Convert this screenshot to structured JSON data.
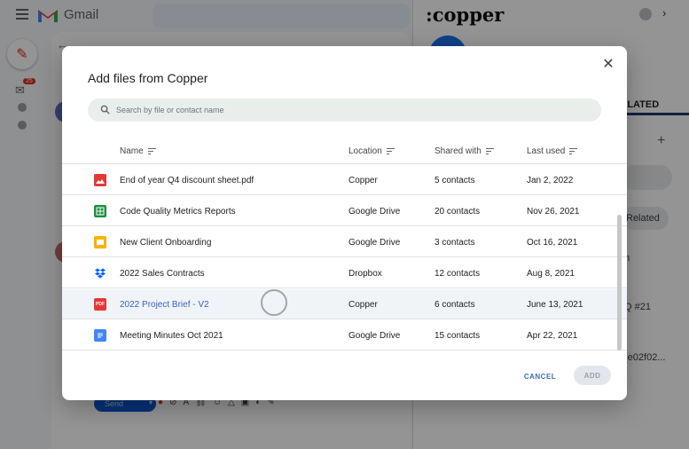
{
  "gmail": {
    "title": "Gmail",
    "badge_count": "25",
    "send_label": "Send"
  },
  "copper": {
    "logo": ":copper",
    "tab_label": "ELATED",
    "related_label": "Related",
    "fragment_1": "h",
    "fragment_2": "Q #21",
    "fragment_3": "(e02f02..."
  },
  "modal": {
    "title": "Add files from Copper",
    "search_placeholder": "Search by file or contact name",
    "columns": {
      "name": "Name",
      "location": "Location",
      "shared_with": "Shared with",
      "last_used": "Last used"
    },
    "files": [
      {
        "name": "End of year Q4 discount sheet.pdf",
        "location": "Copper",
        "shared_with": "5 contacts",
        "last_used": "Jan 2, 2022",
        "icon": "image-file-icon"
      },
      {
        "name": "Code Quality Metrics Reports",
        "location": "Google Drive",
        "shared_with": "20 contacts",
        "last_used": "Nov 26, 2021",
        "icon": "google-sheets-icon"
      },
      {
        "name": "New Client Onboarding",
        "location": "Google Drive",
        "shared_with": "3 contacts",
        "last_used": "Oct 16, 2021",
        "icon": "google-slides-icon"
      },
      {
        "name": "2022 Sales Contracts",
        "location": "Dropbox",
        "shared_with": "12 contacts",
        "last_used": "Aug 8, 2021",
        "icon": "dropbox-icon"
      },
      {
        "name": "2022 Project Brief - V2",
        "location": "Copper",
        "shared_with": "6 contacts",
        "last_used": "June 13, 2021",
        "icon": "pdf-file-icon",
        "selected": true,
        "pdf_label": "PDF"
      },
      {
        "name": "Meeting Minutes Oct 2021",
        "location": "Google Drive",
        "shared_with": "15 contacts",
        "last_used": "Apr 22, 2021",
        "icon": "google-docs-icon"
      }
    ],
    "cancel_label": "CANCEL",
    "add_label": "ADD"
  },
  "colors": {
    "accent_blue": "#3b6fb5",
    "selected_row_bg": "#f0f4f9",
    "search_bg": "#e9eeeb"
  }
}
